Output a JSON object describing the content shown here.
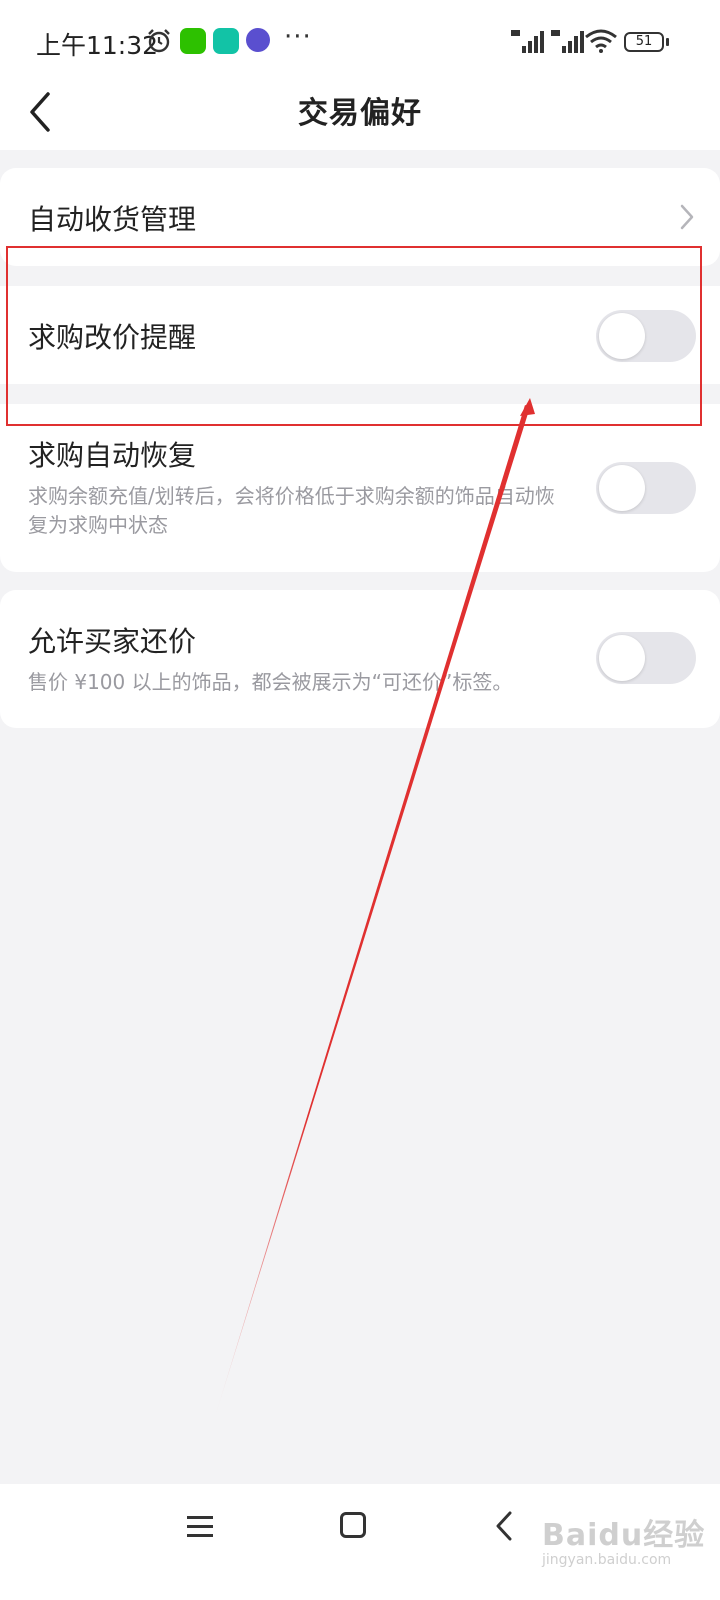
{
  "status_bar": {
    "time": "上午11:32",
    "dots": "···",
    "battery": "51"
  },
  "header": {
    "title": "交易偏好"
  },
  "settings": {
    "auto_receive": {
      "label": "自动收货管理"
    },
    "buy_price_alert": {
      "label": "求购改价提醒",
      "enabled": false
    },
    "buy_auto_restore": {
      "label": "求购自动恢复",
      "description": "求购余额充值/划转后，会将价格低于求购余额的饰品自动恢复为求购中状态",
      "enabled": false
    },
    "allow_counter_offer": {
      "label": "允许买家还价",
      "description": "售价 ¥100 以上的饰品，都会被展示为“可还价”标签。",
      "enabled": false
    }
  },
  "watermark": {
    "brand": "Baidu经验",
    "url": "jingyan.baidu.com"
  }
}
